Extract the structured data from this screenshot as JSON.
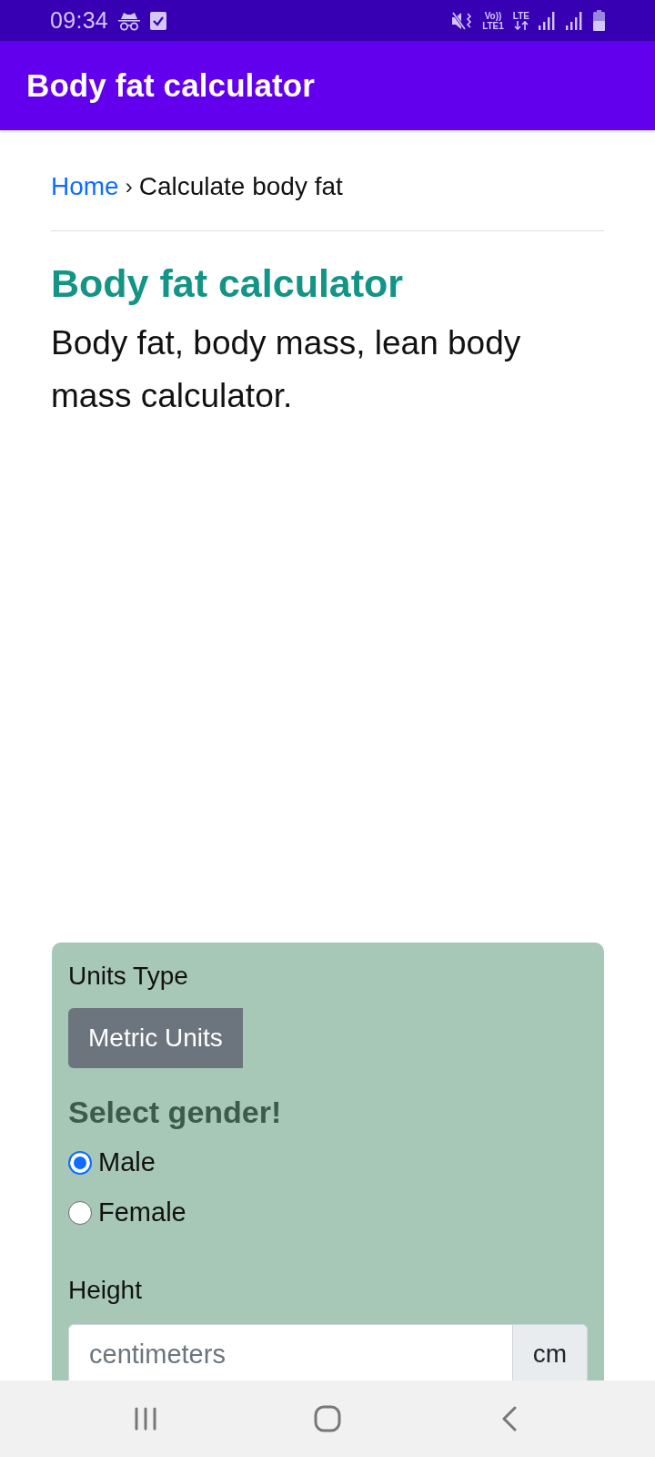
{
  "status_bar": {
    "time": "09:34",
    "volte": [
      "Vo))",
      "LTE1"
    ],
    "data_label": "LTE"
  },
  "app_bar": {
    "title": "Body fat calculator"
  },
  "breadcrumb": {
    "separator": "›",
    "items": [
      {
        "label": "Home",
        "kind": "link"
      },
      {
        "label": "Calculate body fat",
        "kind": "current"
      }
    ]
  },
  "page": {
    "heading": "Body fat calculator",
    "description": "Body fat, body mass, lean body mass calculator."
  },
  "form": {
    "units_label": "Units Type",
    "units_button": "Metric Units",
    "gender_heading": "Select gender!",
    "gender_options": [
      {
        "label": "Male",
        "selected": true
      },
      {
        "label": "Female",
        "selected": false
      }
    ],
    "height": {
      "label": "Height",
      "placeholder": "centimeters",
      "unit": "cm"
    }
  }
}
